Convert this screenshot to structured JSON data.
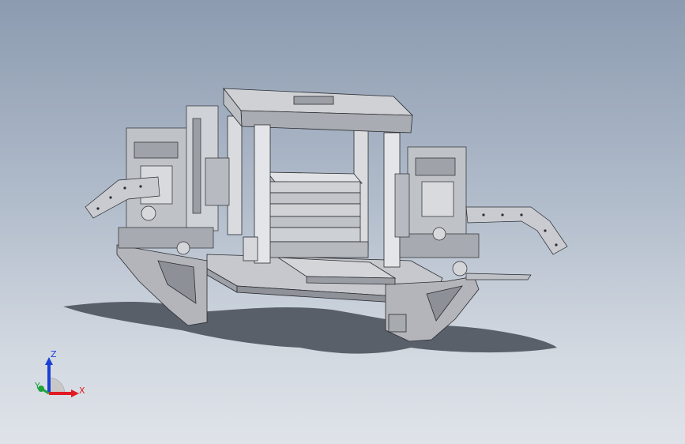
{
  "viewport": {
    "background_top": "#8c9bb0",
    "background_bottom": "#dfe3e9",
    "model_color": "#c9cbd0",
    "shadow_color": "#3f4650"
  },
  "triad": {
    "x_label": "X",
    "y_label": "Y",
    "z_label": "Z",
    "x_color": "#e01b24",
    "y_color": "#1fa33b",
    "z_color": "#1a3fd6"
  }
}
